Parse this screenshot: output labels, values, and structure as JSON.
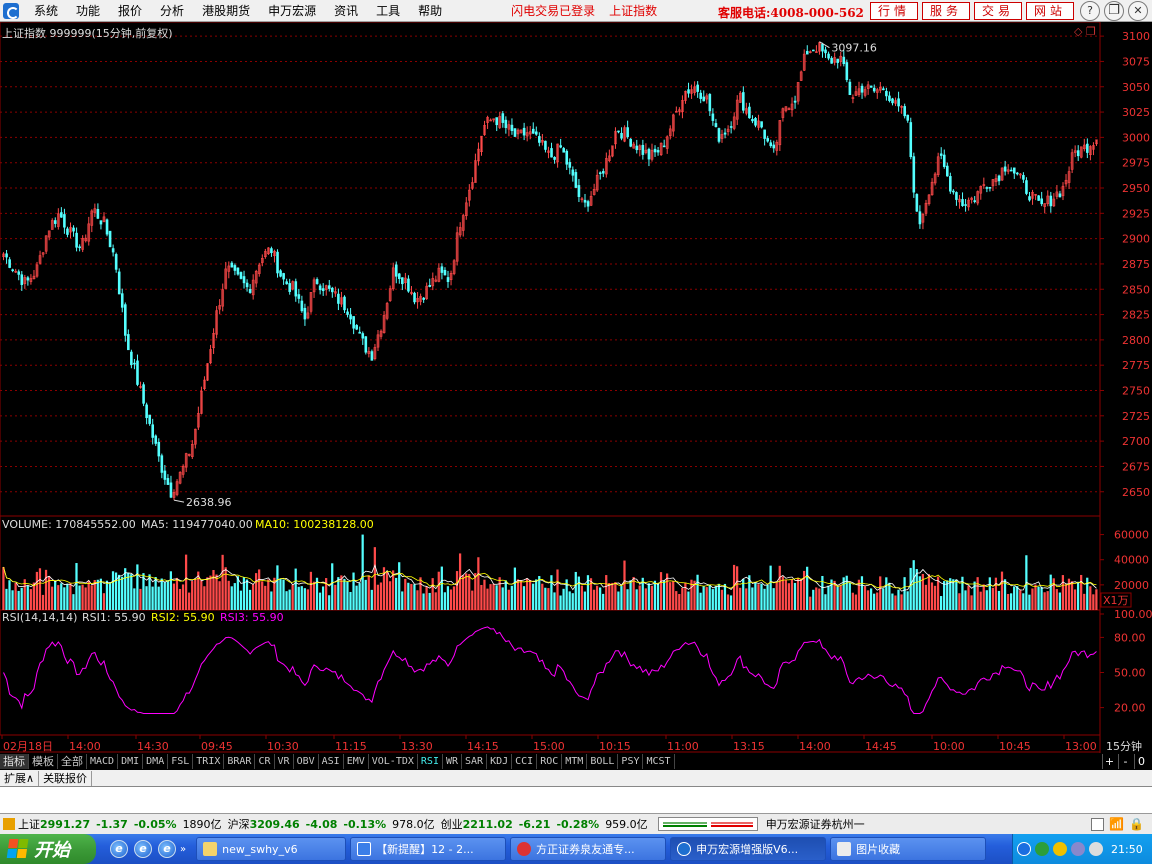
{
  "menubar": {
    "items": [
      "系统",
      "功能",
      "报价",
      "分析",
      "港股期货",
      "申万宏源",
      "资讯",
      "工具",
      "帮助"
    ],
    "status_login": "闪电交易已登录",
    "status_index": "上证指数",
    "hotline": "客服电话:4008-000-562",
    "quick_buttons": [
      "行情",
      "服务",
      "交易",
      "网站"
    ],
    "window_controls": [
      "help-icon",
      "minimize-icon",
      "restore-icon",
      "close-icon"
    ]
  },
  "chart": {
    "title": "上证指数 999999(15分钟,前复权)",
    "high_label": "3097.16",
    "low_label": "2638.96",
    "price_ticks": [
      "3100",
      "3075",
      "3050",
      "3025",
      "3000",
      "2975",
      "2950",
      "2925",
      "2900",
      "2875",
      "2850",
      "2825",
      "2800",
      "2775",
      "2750",
      "2725",
      "2700",
      "2675",
      "2650"
    ],
    "volume_header": {
      "volume": "VOLUME: 170845552.00",
      "ma5": "MA5: 119477040.00",
      "ma10": "MA10: 100238128.00"
    },
    "volume_ticks": [
      "60000",
      "40000",
      "20000"
    ],
    "volume_unit": "X1万",
    "rsi_header": {
      "name": "RSI(14,14,14)",
      "rsi1": "RSI1: 55.90",
      "rsi2": "RSI2: 55.90",
      "rsi3": "RSI3: 55.90"
    },
    "rsi_ticks": [
      "100.00",
      "80.00",
      "50.00",
      "20.00"
    ],
    "time_axis": [
      "02月18日",
      "14:00",
      "14:30",
      "09:45",
      "10:30",
      "11:15",
      "13:30",
      "14:15",
      "15:00",
      "10:15",
      "11:00",
      "13:15",
      "14:00",
      "14:45",
      "10:00",
      "10:45",
      "13:00"
    ],
    "period": "15分钟",
    "colors": {
      "up": "#ff4a4a",
      "down": "#54ffff",
      "grid": "#8b0000",
      "ma5": "#ffffff",
      "ma10": "#ffff00",
      "rsi": "#ff00ff"
    }
  },
  "chart_data": {
    "type": "candlestick",
    "title": "上证指数 999999(15分钟,前复权)",
    "ylim": [
      2630,
      3110
    ],
    "high": 3097.16,
    "low": 2638.96,
    "close_path": [
      2885,
      2870,
      2855,
      2870,
      2910,
      2925,
      2905,
      2890,
      2930,
      2915,
      2880,
      2800,
      2760,
      2720,
      2680,
      2650,
      2670,
      2700,
      2760,
      2820,
      2870,
      2860,
      2850,
      2880,
      2890,
      2860,
      2850,
      2820,
      2860,
      2850,
      2840,
      2830,
      2800,
      2785,
      2820,
      2870,
      2860,
      2840,
      2850,
      2865,
      2860,
      2920,
      2960,
      3010,
      3020,
      3010,
      3000,
      3005,
      2995,
      2980,
      2990,
      2960,
      2930,
      2950,
      2975,
      3010,
      3000,
      2990,
      2980,
      2990,
      3015,
      3045,
      3050,
      3040,
      3000,
      3010,
      3040,
      3020,
      3010,
      2980,
      3030,
      3040,
      3085,
      3090,
      3075,
      3080,
      3040,
      3050,
      3045,
      3050,
      3030,
      3020,
      2910,
      2950,
      2980,
      2950,
      2935,
      2940,
      2955,
      2960,
      2975,
      2960,
      2945,
      2930,
      2940,
      2950,
      2985,
      2990,
      3000
    ],
    "volume": {
      "unit": "X1万",
      "ticks": [
        20000,
        40000,
        60000
      ],
      "last": 170845552.0,
      "ma5": 119477040.0,
      "ma10": 100238128.0
    },
    "rsi": {
      "ticks": [
        20,
        50,
        80,
        100
      ],
      "rsi1": 55.9,
      "rsi2": 55.9,
      "rsi3": 55.9
    },
    "xlabels": [
      "02月18日",
      "14:00",
      "14:30",
      "09:45",
      "10:30",
      "11:15",
      "13:30",
      "14:15",
      "15:00",
      "10:15",
      "11:00",
      "13:15",
      "14:00",
      "14:45",
      "10:00",
      "10:45",
      "13:00"
    ]
  },
  "tabs": [
    "指标",
    "模板",
    "全部",
    "MACD",
    "DMI",
    "DMA",
    "FSL",
    "TRIX",
    "BRAR",
    "CR",
    "VR",
    "OBV",
    "ASI",
    "EMV",
    "VOL-TDX",
    "RSI",
    "WR",
    "SAR",
    "KDJ",
    "CCI",
    "ROC",
    "MTM",
    "BOLL",
    "PSY",
    "MCST"
  ],
  "tabs_active": "RSI",
  "tab_controls": [
    "+",
    "-",
    "0"
  ],
  "ext_row": [
    "扩展∧",
    "关联报价"
  ],
  "statusbar": {
    "sh_name": "上证",
    "sh_value": "2991.27",
    "sh_change": "-1.37",
    "sh_pct": "-0.05%",
    "sh_amount": "1890亿",
    "hs_name": "沪深",
    "hs_value": "3209.46",
    "hs_change": "-4.08",
    "hs_pct": "-0.13%",
    "hs_amount": "978.0亿",
    "cy_name": "创业",
    "cy_value": "2211.02",
    "cy_change": "-6.21",
    "cy_pct": "-0.28%",
    "cy_amount": "959.0亿",
    "server": "申万宏源证券杭州一"
  },
  "taskbar": {
    "start": "开始",
    "tasks": [
      "new_swhy_v6",
      "【新提醒】12 - 2...",
      "方正证券泉友通专...",
      "申万宏源增强版V6...",
      "图片收藏"
    ],
    "clock": "21:50"
  }
}
